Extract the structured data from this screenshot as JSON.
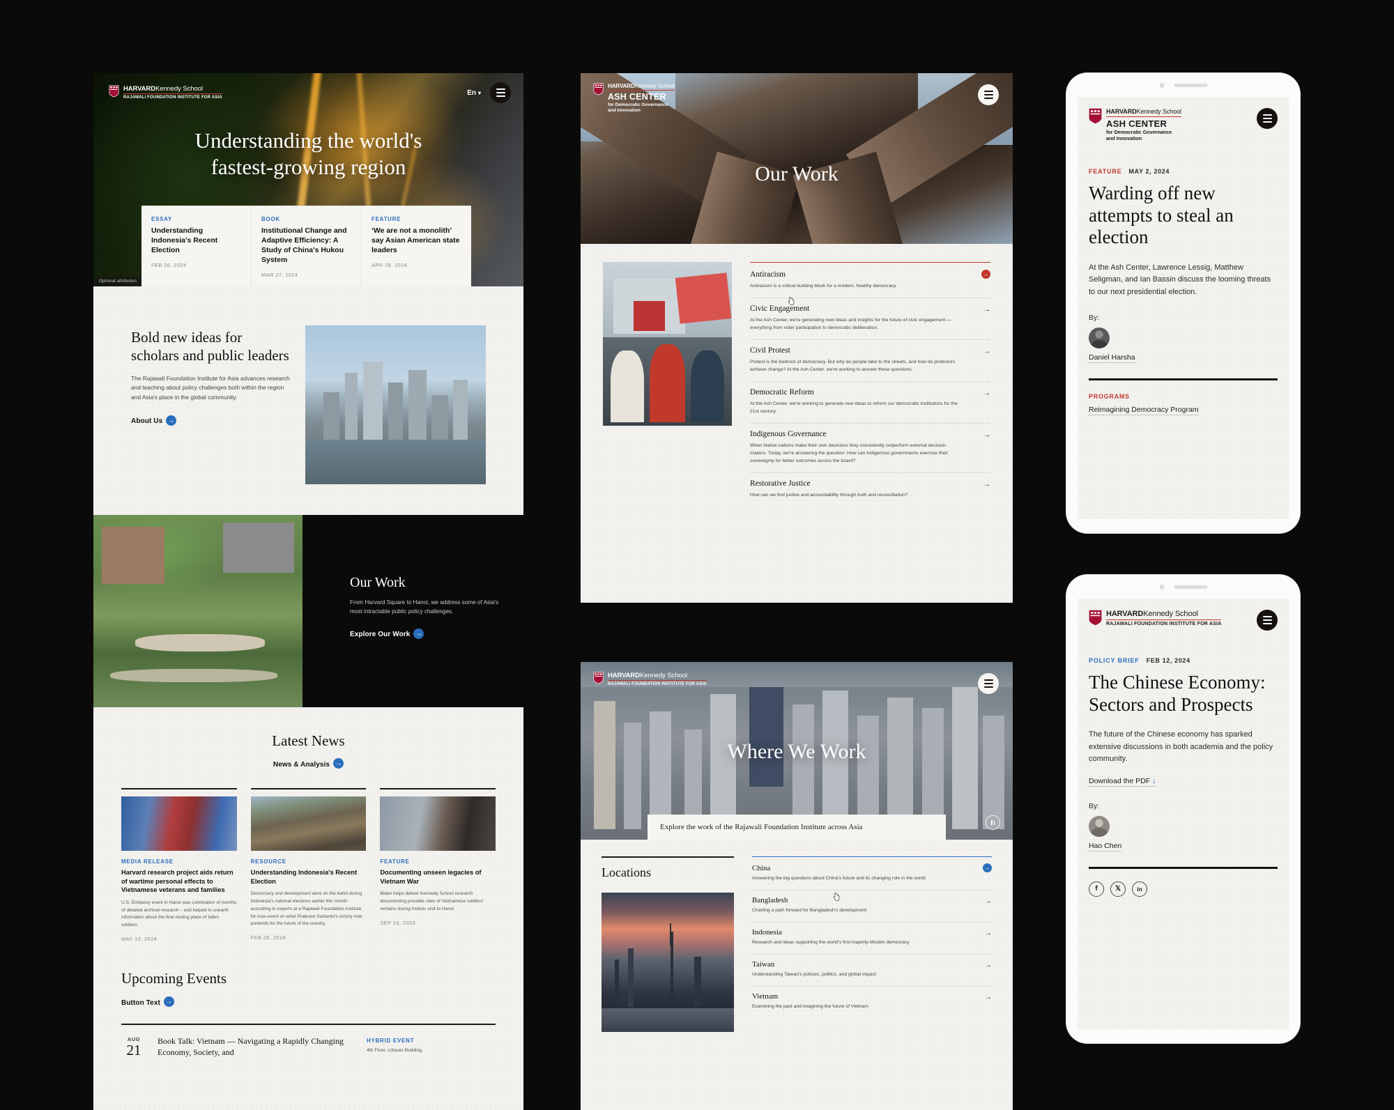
{
  "left_desktop": {
    "logo": {
      "line1_bold": "HARVARD",
      "line1_thin": "Kennedy School",
      "line2": "RAJAWALI FOUNDATION INSTITUTE FOR ASIA"
    },
    "nav": {
      "language": "En",
      "chevron": "∨",
      "menu_icon": "hamburger-icon"
    },
    "hero": {
      "title_line1": "Understanding the world's",
      "title_line2": "fastest-growing region",
      "caption": "Optional attribution"
    },
    "hero_cards": [
      {
        "eyebrow": "ESSAY",
        "title": "Understanding Indonesia's Recent Election",
        "date": "FEB 26, 2024"
      },
      {
        "eyebrow": "BOOK",
        "title": "Institutional Change and Adaptive Efficiency: A Study of China's Hukou System",
        "date": "MAR 27, 2024"
      },
      {
        "eyebrow": "FEATURE",
        "title": "‘We are not a monolith’ say Asian American state leaders",
        "date": "APR 28, 2024"
      }
    ],
    "bold_section": {
      "heading": "Bold new ideas for scholars and public leaders",
      "body": "The Rajawali Foundation Institute for Asia advances research and teaching about policy challenges both within the region and Asia's place in the global community.",
      "cta": "About Us"
    },
    "our_work": {
      "heading": "Our Work",
      "body": "From Harvard Square to Hanoi, we address some of Asia's most intractable public policy challenges.",
      "cta": "Explore Our Work"
    },
    "latest_news": {
      "heading": "Latest News",
      "cta": "News & Analysis",
      "cards": [
        {
          "eyebrow": "MEDIA RELEASE",
          "title": "Harvard research project aids return of wartime personal effects to Vietnamese veterans and families",
          "body": "U.S. Embassy event in Hanoi was culmination of months of detailed archival research – and helped to unearth information about the final resting place of fallen soldiers.",
          "date": "MAY 10, 2024"
        },
        {
          "eyebrow": "RESOURCE",
          "title": "Understanding Indonesia's Recent Election",
          "body": "Democracy and development were on the ballot during Indonesia's national elections earlier this month according to experts at a Rajawali Foundation Institute for Asia event on what Prabowo Subianto's victory now portends for the future of the country.",
          "date": "FEB 26, 2024"
        },
        {
          "eyebrow": "FEATURE",
          "title": "Documenting unseen legacies of Vietnam War",
          "body": "Biden helps deliver Kennedy School research documenting possible sites of Vietnamese soldiers' remains during historic visit to Hanoi",
          "date": "SEP 15, 2023"
        }
      ]
    },
    "upcoming_events": {
      "heading": "Upcoming Events",
      "cta": "Button Text",
      "events": [
        {
          "month": "AUG",
          "day": "21",
          "title": "Book Talk: Vietnam — Navigating a Rapidly Changing Economy, Society, and",
          "type": "HYBRID EVENT",
          "location": "4th Floor, Littauer Building,"
        }
      ]
    }
  },
  "mid_our_work": {
    "logo": {
      "line1_bold": "HARVARD",
      "line1_thin": "Kennedy School",
      "big": "ASH CENTER",
      "sub_line1": "for Democratic Governance",
      "sub_line2": "and Innovation"
    },
    "menu_icon": "hamburger-icon",
    "hero_title": "Our Work",
    "photo_alt": "protest-photo",
    "accordion": [
      {
        "title": "Antiracism",
        "body": "Antiracism is a critical building block for a modern, healthy democracy",
        "active": true,
        "arrow": "→"
      },
      {
        "title": "Civic Engagement",
        "body": "At the Ash Center, we're generating new ideas and insights for the future of civic engagement — everything from voter participation to democratic deliberation.",
        "active": false,
        "arrow": "→"
      },
      {
        "title": "Civil Protest",
        "body": "Protest is the bedrock of democracy. But why do people take to the streets, and how do protestors achieve change? At the Ash Center, we're working to answer these questions.",
        "active": false,
        "arrow": "→"
      },
      {
        "title": "Democratic Reform",
        "body": "At the Ash Center, we're working to generate new ideas to reform our democratic institutions for the 21st century.",
        "active": false,
        "arrow": "→"
      },
      {
        "title": "Indigenous Governance",
        "body": "When Native nations make their own decisions they consistently outperform external decision-makers. Today, we're answering the question: How can Indigenous governments exercise their sovereignty for better outcomes across the board?",
        "active": false,
        "arrow": "→"
      },
      {
        "title": "Restorative Justice",
        "body": "How can we find justice and accountability through truth and reconciliation?",
        "active": false,
        "arrow": "→"
      }
    ]
  },
  "mid_where_we_work": {
    "logo": {
      "line1_bold": "HARVARD",
      "line1_thin": "Kennedy School",
      "line2": "RAJAWALI FOUNDATION INSTITUTE FOR ASIA"
    },
    "menu_icon": "hamburger-icon",
    "hero_title": "Where We Work",
    "caption": "Explore the work of the Rajawali Foundation Institute across Asia",
    "pause_icon": "pause-icon",
    "locations_heading": "Locations",
    "locations": [
      {
        "title": "China",
        "body": "Answering the big questions about China's future and its changing role in the world",
        "active": true,
        "arrow": "→"
      },
      {
        "title": "Bangladesh",
        "body": "Charting a path forward for Bangladesh's development",
        "active": false,
        "arrow": "→"
      },
      {
        "title": "Indonesia",
        "body": "Research and ideas supporting the world's first majority-Muslim democracy",
        "active": false,
        "arrow": "→"
      },
      {
        "title": "Taiwan",
        "body": "Understanding Taiwan's policies, politics, and global impact",
        "active": false,
        "arrow": "→"
      },
      {
        "title": "Vietnam",
        "body": "Examining the past and imagining the future of Vietnam",
        "active": false,
        "arrow": "→"
      }
    ]
  },
  "phone1": {
    "logo": {
      "line1_bold": "HARVARD",
      "line1_thin": "Kennedy School",
      "big": "ASH CENTER",
      "sub_line1": "for Democratic Governance",
      "sub_line2": "and Innovation"
    },
    "menu_icon": "hamburger-icon",
    "eyebrow": "FEATURE",
    "date": "MAY 2, 2024",
    "title": "Warding off new attempts to steal an election",
    "body": "At the Ash Center, Lawrence Lessig, Matthew Seligman, and Ian Bassin discuss the looming threats to our next presidential election.",
    "by_label": "By:",
    "author": "Daniel Harsha",
    "programs_label": "PROGRAMS",
    "program": "Reimagining Democracy Program"
  },
  "phone2": {
    "logo": {
      "line1_bold": "HARVARD",
      "line1_thin": "Kennedy School",
      "line2": "RAJAWALI FOUNDATION INSTITUTE FOR ASIA"
    },
    "menu_icon": "hamburger-icon",
    "eyebrow": "POLICY BRIEF",
    "date": "FEB 12, 2024",
    "title": "The Chinese Economy: Sectors and Prospects",
    "body": "The future of the Chinese economy has sparked extensive discussions in both academia and the policy community.",
    "download": "Download the PDF",
    "download_icon": "↓",
    "by_label": "By:",
    "author": "Hao Chen",
    "socials": [
      {
        "name": "facebook-icon",
        "glyph": "f"
      },
      {
        "name": "x-twitter-icon",
        "glyph": "𝕏"
      },
      {
        "name": "linkedin-icon",
        "glyph": "in"
      }
    ]
  },
  "colors": {
    "crimson": "#c3372b",
    "blue": "#2a6ebb",
    "paper": "#f2f1ee",
    "ink": "#111111",
    "background": "#0a0a0a"
  }
}
